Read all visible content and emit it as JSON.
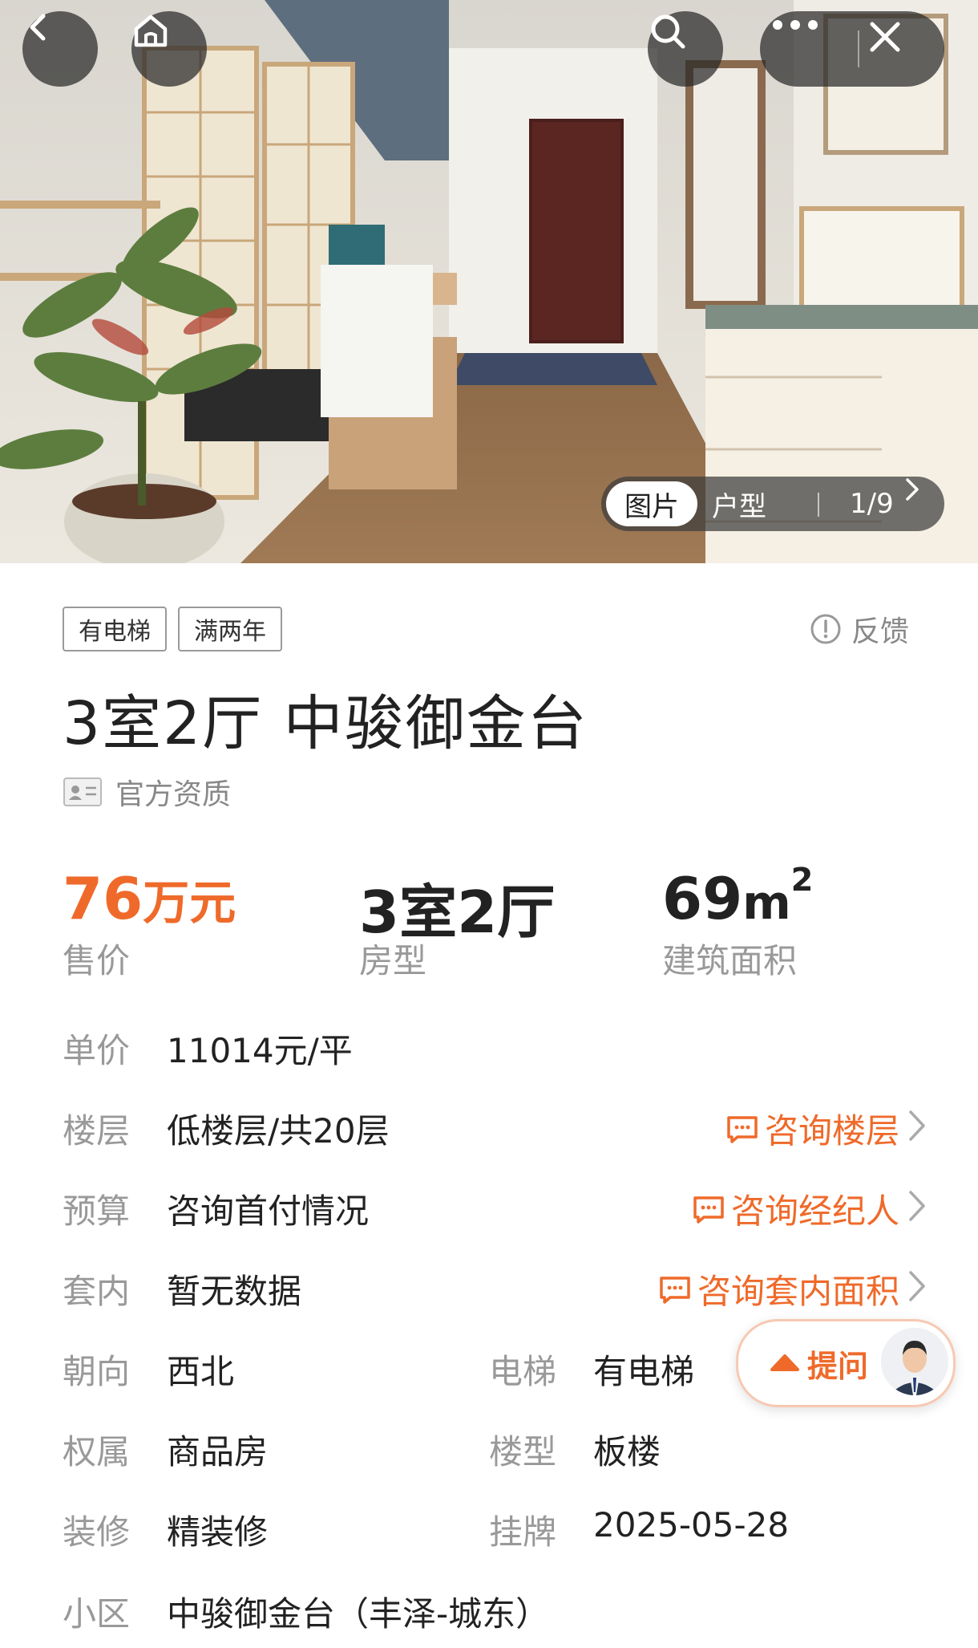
{
  "header": {
    "back_icon": "back-arrow-icon",
    "home_icon": "home-icon",
    "search_icon": "search-icon",
    "more_icon": "more-dots-icon",
    "close_icon": "close-icon"
  },
  "gallery": {
    "tab_photos": "图片",
    "tab_floorplan": "户型",
    "counter": "1/9"
  },
  "tags": [
    "有电梯",
    "满两年"
  ],
  "feedback_label": "反馈",
  "title": "3室2厅 中骏御金台",
  "qualification_label": "官方资质",
  "stats": {
    "price_number": "76",
    "price_unit": "万元",
    "price_label": "售价",
    "layout_value": "3室2厅",
    "layout_label": "房型",
    "area_number": "69",
    "area_unit": "m",
    "area_sup": "2",
    "area_label": "建筑面积"
  },
  "details": {
    "unit_price": {
      "label": "单价",
      "value": "11014元/平"
    },
    "floor": {
      "label": "楼层",
      "value": "低楼层/共20层",
      "action": "咨询楼层"
    },
    "budget": {
      "label": "预算",
      "value": "咨询首付情况",
      "action": "咨询经纪人"
    },
    "inner": {
      "label": "套内",
      "value": "暂无数据",
      "action": "咨询套内面积"
    },
    "orientation": {
      "label": "朝向",
      "value": "西北"
    },
    "elevator": {
      "label": "电梯",
      "value": "有电梯"
    },
    "ownership": {
      "label": "权属",
      "value": "商品房"
    },
    "building_type": {
      "label": "楼型",
      "value": "板楼"
    },
    "decoration": {
      "label": "装修",
      "value": "精装修"
    },
    "listed": {
      "label": "挂牌",
      "value": "2025-05-28"
    },
    "community": {
      "label": "小区",
      "value": "中骏御金台（丰泽-城东）"
    }
  },
  "ask_button": {
    "label": "提问"
  },
  "colors": {
    "accent": "#ef6a2a",
    "muted": "#999999",
    "text": "#222222"
  }
}
